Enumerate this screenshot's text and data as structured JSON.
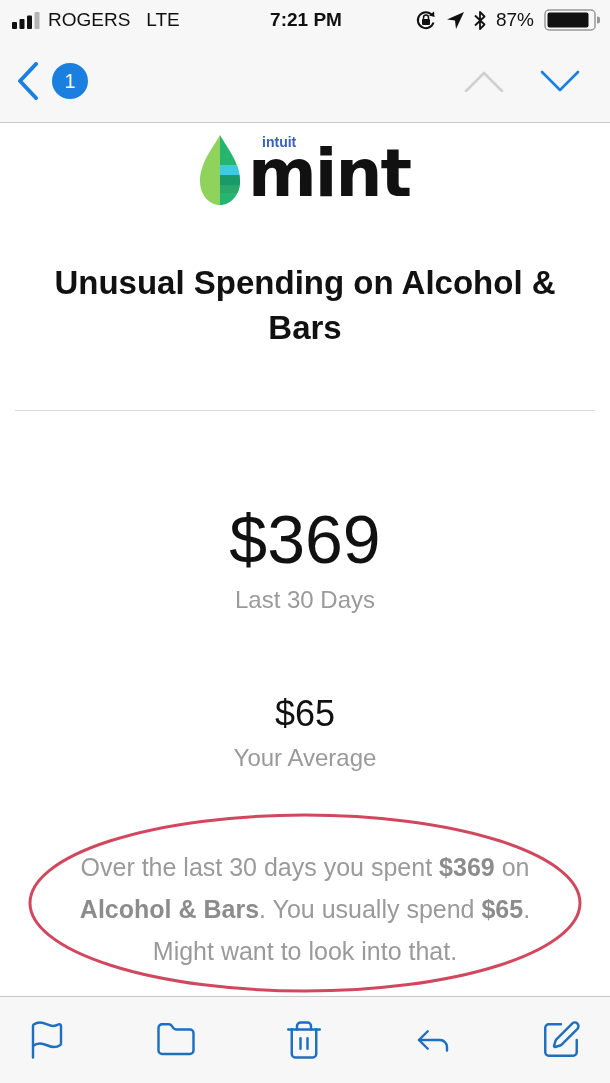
{
  "status_bar": {
    "carrier": "ROGERS",
    "network": "LTE",
    "time": "7:21 PM",
    "battery": "87%"
  },
  "nav_bar": {
    "badge": "1",
    "previous_enabled": false,
    "next_enabled": true
  },
  "email": {
    "logo": {
      "brand": "intuit",
      "product": "mint"
    },
    "title": "Unusual Spending on Alcohol & Bars",
    "stats": [
      {
        "kind": "primary",
        "amount": "$369",
        "caption": "Last 30 Days"
      },
      {
        "kind": "secondary",
        "amount": "$65",
        "caption": "Your Average"
      }
    ],
    "message": {
      "text": "Over the last 30 days you spent **$369** on **Alcohol & Bars**. You usually spend **$65**. Might want to look into that.",
      "circled": true
    }
  }
}
